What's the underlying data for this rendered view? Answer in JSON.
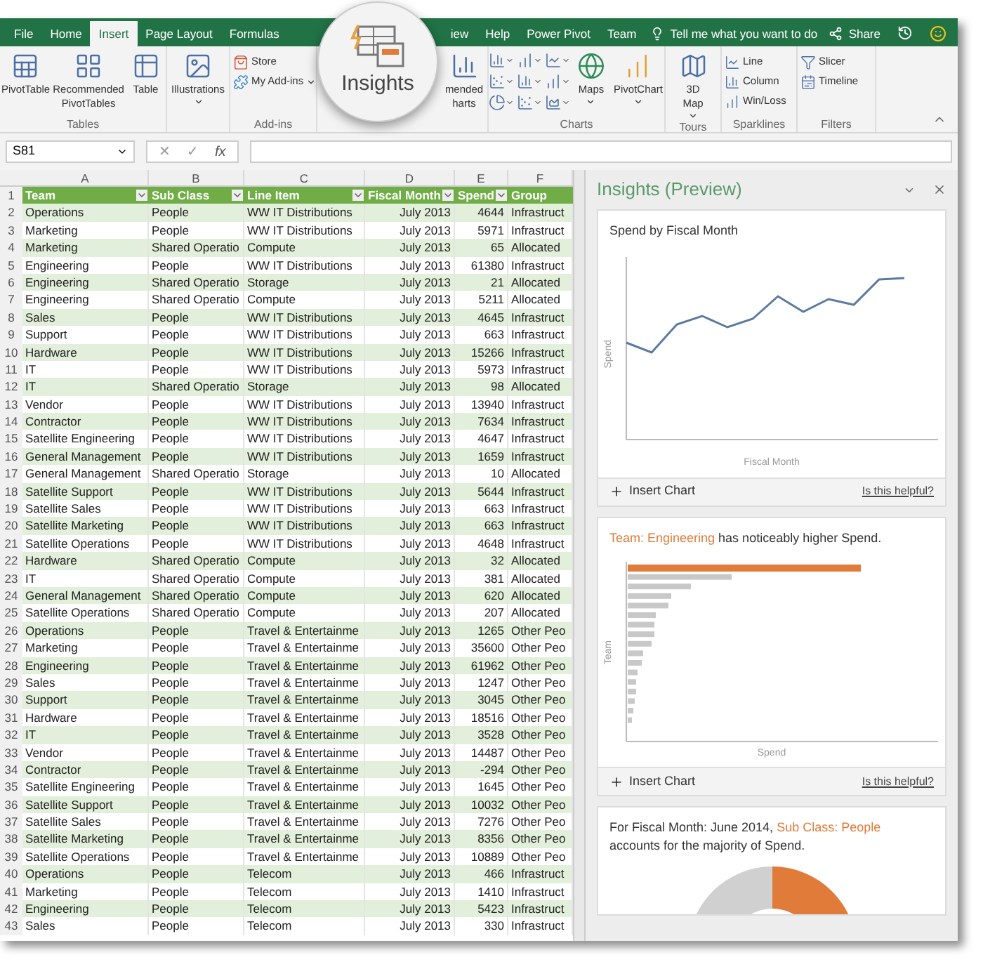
{
  "ribbon_tabs": [
    {
      "label": "File",
      "selected": false
    },
    {
      "label": "Home",
      "selected": false
    },
    {
      "label": "Insert",
      "selected": true
    },
    {
      "label": "Page Layout",
      "selected": false
    },
    {
      "label": "Formulas",
      "selected": false
    },
    {
      "label": "iew",
      "selected": false
    },
    {
      "label": "Help",
      "selected": false
    },
    {
      "label": "Power Pivot",
      "selected": false
    },
    {
      "label": "Team",
      "selected": false
    }
  ],
  "tell_me": "Tell me what you want to do",
  "share": "Share",
  "ribbon_groups": [
    {
      "name": "Tables",
      "items": [
        {
          "kind": "large",
          "label": "PivotTable"
        },
        {
          "kind": "large",
          "label": "Recommended\nPivotTables"
        },
        {
          "kind": "large",
          "label": "Table"
        }
      ]
    },
    {
      "items": [
        {
          "kind": "large",
          "label": "Illustrations",
          "dropdown": true
        }
      ]
    },
    {
      "name": "Add-ins",
      "items": [
        {
          "kind": "small",
          "label": "Store"
        },
        {
          "kind": "small",
          "label": "My Add-ins",
          "dropdown": true
        }
      ]
    },
    {
      "items": [
        {
          "kind": "spacer"
        },
        {
          "kind": "large",
          "label": "mended\nharts"
        }
      ]
    },
    {
      "name": "Charts",
      "items": [
        {
          "kind": "chartgrid"
        },
        {
          "kind": "large",
          "label": "Maps",
          "dropdown": true
        },
        {
          "kind": "large",
          "label": "PivotChart",
          "dropdown": true
        }
      ]
    },
    {
      "name": "Tours",
      "items": [
        {
          "kind": "large",
          "label": "3D\nMap",
          "dropdown": true
        }
      ]
    },
    {
      "name": "Sparklines",
      "items": [
        {
          "kind": "small",
          "label": "Line"
        },
        {
          "kind": "small",
          "label": "Column"
        },
        {
          "kind": "small",
          "label": "Win/Loss"
        }
      ]
    },
    {
      "name": "Filters",
      "items": [
        {
          "kind": "small",
          "label": "Slicer"
        },
        {
          "kind": "small",
          "label": "Timeline"
        }
      ]
    }
  ],
  "magnifier": {
    "label": "Insights"
  },
  "name_box": "S81",
  "formula_icons": {
    "cancel": "✕",
    "enter": "✓",
    "function": "fx"
  },
  "columns": [
    "A",
    "B",
    "C",
    "D",
    "E",
    "F"
  ],
  "header_row": {
    "number": "1",
    "cells": [
      "Team",
      "Sub Class",
      "Line Item",
      "Fiscal Month",
      "Spend",
      "Group"
    ]
  },
  "rows": [
    {
      "number": "2",
      "cells": [
        "Operations",
        "People",
        "WW IT Distributions",
        "July 2013",
        "4644",
        "Infrastruct"
      ]
    },
    {
      "number": "3",
      "cells": [
        "Marketing",
        "People",
        "WW IT Distributions",
        "July 2013",
        "5971",
        "Infrastruct"
      ]
    },
    {
      "number": "4",
      "cells": [
        "Marketing",
        "Shared Operatio",
        "Compute",
        "July 2013",
        "65",
        "Allocated"
      ]
    },
    {
      "number": "5",
      "cells": [
        "Engineering",
        "People",
        "WW IT Distributions",
        "July 2013",
        "61380",
        "Infrastruct"
      ]
    },
    {
      "number": "6",
      "cells": [
        "Engineering",
        "Shared Operatio",
        "Storage",
        "July 2013",
        "21",
        "Allocated"
      ]
    },
    {
      "number": "7",
      "cells": [
        "Engineering",
        "Shared Operatio",
        "Compute",
        "July 2013",
        "5211",
        "Allocated"
      ]
    },
    {
      "number": "8",
      "cells": [
        "Sales",
        "People",
        "WW IT Distributions",
        "July 2013",
        "4645",
        "Infrastruct"
      ]
    },
    {
      "number": "9",
      "cells": [
        "Support",
        "People",
        "WW IT Distributions",
        "July 2013",
        "663",
        "Infrastruct"
      ]
    },
    {
      "number": "10",
      "cells": [
        "Hardware",
        "People",
        "WW IT Distributions",
        "July 2013",
        "15266",
        "Infrastruct"
      ]
    },
    {
      "number": "11",
      "cells": [
        "IT",
        "People",
        "WW IT Distributions",
        "July 2013",
        "5973",
        "Infrastruct"
      ]
    },
    {
      "number": "12",
      "cells": [
        "IT",
        "Shared Operatio",
        "Storage",
        "July 2013",
        "98",
        "Allocated"
      ]
    },
    {
      "number": "13",
      "cells": [
        "Vendor",
        "People",
        "WW IT Distributions",
        "July 2013",
        "13940",
        "Infrastruct"
      ]
    },
    {
      "number": "14",
      "cells": [
        "Contractor",
        "People",
        "WW IT Distributions",
        "July 2013",
        "7634",
        "Infrastruct"
      ]
    },
    {
      "number": "15",
      "cells": [
        "Satellite Engineering",
        "People",
        "WW IT Distributions",
        "July 2013",
        "4647",
        "Infrastruct"
      ]
    },
    {
      "number": "16",
      "cells": [
        "General Management",
        "People",
        "WW IT Distributions",
        "July 2013",
        "1659",
        "Infrastruct"
      ]
    },
    {
      "number": "17",
      "cells": [
        "General Management",
        "Shared Operatio",
        "Storage",
        "July 2013",
        "10",
        "Allocated"
      ]
    },
    {
      "number": "18",
      "cells": [
        "Satellite Support",
        "People",
        "WW IT Distributions",
        "July 2013",
        "5644",
        "Infrastruct"
      ]
    },
    {
      "number": "19",
      "cells": [
        "Satellite Sales",
        "People",
        "WW IT Distributions",
        "July 2013",
        "663",
        "Infrastruct"
      ]
    },
    {
      "number": "20",
      "cells": [
        "Satellite Marketing",
        "People",
        "WW IT Distributions",
        "July 2013",
        "663",
        "Infrastruct"
      ]
    },
    {
      "number": "21",
      "cells": [
        "Satellite Operations",
        "People",
        "WW IT Distributions",
        "July 2013",
        "4648",
        "Infrastruct"
      ]
    },
    {
      "number": "22",
      "cells": [
        "Hardware",
        "Shared Operatio",
        "Compute",
        "July 2013",
        "32",
        "Allocated"
      ]
    },
    {
      "number": "23",
      "cells": [
        "IT",
        "Shared Operatio",
        "Compute",
        "July 2013",
        "381",
        "Allocated"
      ]
    },
    {
      "number": "24",
      "cells": [
        "General Management",
        "Shared Operatio",
        "Compute",
        "July 2013",
        "620",
        "Allocated"
      ]
    },
    {
      "number": "25",
      "cells": [
        "Satellite Operations",
        "Shared Operatio",
        "Compute",
        "July 2013",
        "207",
        "Allocated"
      ]
    },
    {
      "number": "26",
      "cells": [
        "Operations",
        "People",
        "Travel & Entertainme",
        "July 2013",
        "1265",
        "Other Peo"
      ]
    },
    {
      "number": "27",
      "cells": [
        "Marketing",
        "People",
        "Travel & Entertainme",
        "July 2013",
        "35600",
        "Other Peo"
      ]
    },
    {
      "number": "28",
      "cells": [
        "Engineering",
        "People",
        "Travel & Entertainme",
        "July 2013",
        "61962",
        "Other Peo"
      ]
    },
    {
      "number": "29",
      "cells": [
        "Sales",
        "People",
        "Travel & Entertainme",
        "July 2013",
        "1247",
        "Other Peo"
      ]
    },
    {
      "number": "30",
      "cells": [
        "Support",
        "People",
        "Travel & Entertainme",
        "July 2013",
        "3045",
        "Other Peo"
      ]
    },
    {
      "number": "31",
      "cells": [
        "Hardware",
        "People",
        "Travel & Entertainme",
        "July 2013",
        "18516",
        "Other Peo"
      ]
    },
    {
      "number": "32",
      "cells": [
        "IT",
        "People",
        "Travel & Entertainme",
        "July 2013",
        "3528",
        "Other Peo"
      ]
    },
    {
      "number": "33",
      "cells": [
        "Vendor",
        "People",
        "Travel & Entertainme",
        "July 2013",
        "14487",
        "Other Peo"
      ]
    },
    {
      "number": "34",
      "cells": [
        "Contractor",
        "People",
        "Travel & Entertainme",
        "July 2013",
        "-294",
        "Other Peo"
      ]
    },
    {
      "number": "35",
      "cells": [
        "Satellite Engineering",
        "People",
        "Travel & Entertainme",
        "July 2013",
        "1645",
        "Other Peo"
      ]
    },
    {
      "number": "36",
      "cells": [
        "Satellite Support",
        "People",
        "Travel & Entertainme",
        "July 2013",
        "10032",
        "Other Peo"
      ]
    },
    {
      "number": "37",
      "cells": [
        "Satellite Sales",
        "People",
        "Travel & Entertainme",
        "July 2013",
        "7276",
        "Other Peo"
      ]
    },
    {
      "number": "38",
      "cells": [
        "Satellite Marketing",
        "People",
        "Travel & Entertainme",
        "July 2013",
        "8356",
        "Other Peo"
      ]
    },
    {
      "number": "39",
      "cells": [
        "Satellite Operations",
        "People",
        "Travel & Entertainme",
        "July 2013",
        "10889",
        "Other Peo"
      ]
    },
    {
      "number": "40",
      "cells": [
        "Operations",
        "People",
        "Telecom",
        "July 2013",
        "466",
        "Infrastruct"
      ]
    },
    {
      "number": "41",
      "cells": [
        "Marketing",
        "People",
        "Telecom",
        "July 2013",
        "1410",
        "Infrastruct"
      ]
    },
    {
      "number": "42",
      "cells": [
        "Engineering",
        "People",
        "Telecom",
        "July 2013",
        "5423",
        "Infrastruct"
      ]
    },
    {
      "number": "43",
      "cells": [
        "Sales",
        "People",
        "Telecom",
        "July 2013",
        "330",
        "Infrastruct"
      ]
    }
  ],
  "insights_pane": {
    "title": "Insights (Preview)",
    "cards": [
      {
        "kind": "line",
        "title": [
          {
            "text": "Spend by Fiscal Month",
            "highlight": false
          }
        ],
        "ylabel": "Spend",
        "xlabel": "Fiscal Month",
        "insert": "Insert Chart",
        "helpful": "Is this helpful?"
      },
      {
        "kind": "bar",
        "title": [
          {
            "text": "Team: Engineering",
            "highlight": true
          },
          {
            "text": " has noticeably higher Spend.",
            "highlight": false
          }
        ],
        "ylabel": "Team",
        "xlabel": "Spend",
        "insert": "Insert Chart",
        "helpful": "Is this helpful?"
      },
      {
        "kind": "donut",
        "title": [
          {
            "text": "For Fiscal Month: June 2014, ",
            "highlight": false
          },
          {
            "text": "Sub Class: People",
            "highlight": true
          },
          {
            "text": " accounts for the majority of Spend.",
            "highlight": false
          }
        ]
      }
    ]
  }
}
